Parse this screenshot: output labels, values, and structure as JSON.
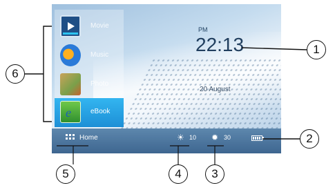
{
  "apps": [
    {
      "label": "Movie",
      "icon": "video-icon"
    },
    {
      "label": "Music",
      "icon": "music-icon"
    },
    {
      "label": "Photo",
      "icon": "photo-icon"
    },
    {
      "label": "eBook",
      "icon": "ebook-icon",
      "selected": true
    }
  ],
  "clock": {
    "ampm": "PM",
    "time": "22:13",
    "date": "20 August"
  },
  "bottom_bar": {
    "home_label": "Home",
    "brightness_value": "10",
    "contrast_value": "30",
    "battery_icon": "battery-icon"
  },
  "callouts": [
    "1",
    "2",
    "3",
    "4",
    "5",
    "6"
  ]
}
